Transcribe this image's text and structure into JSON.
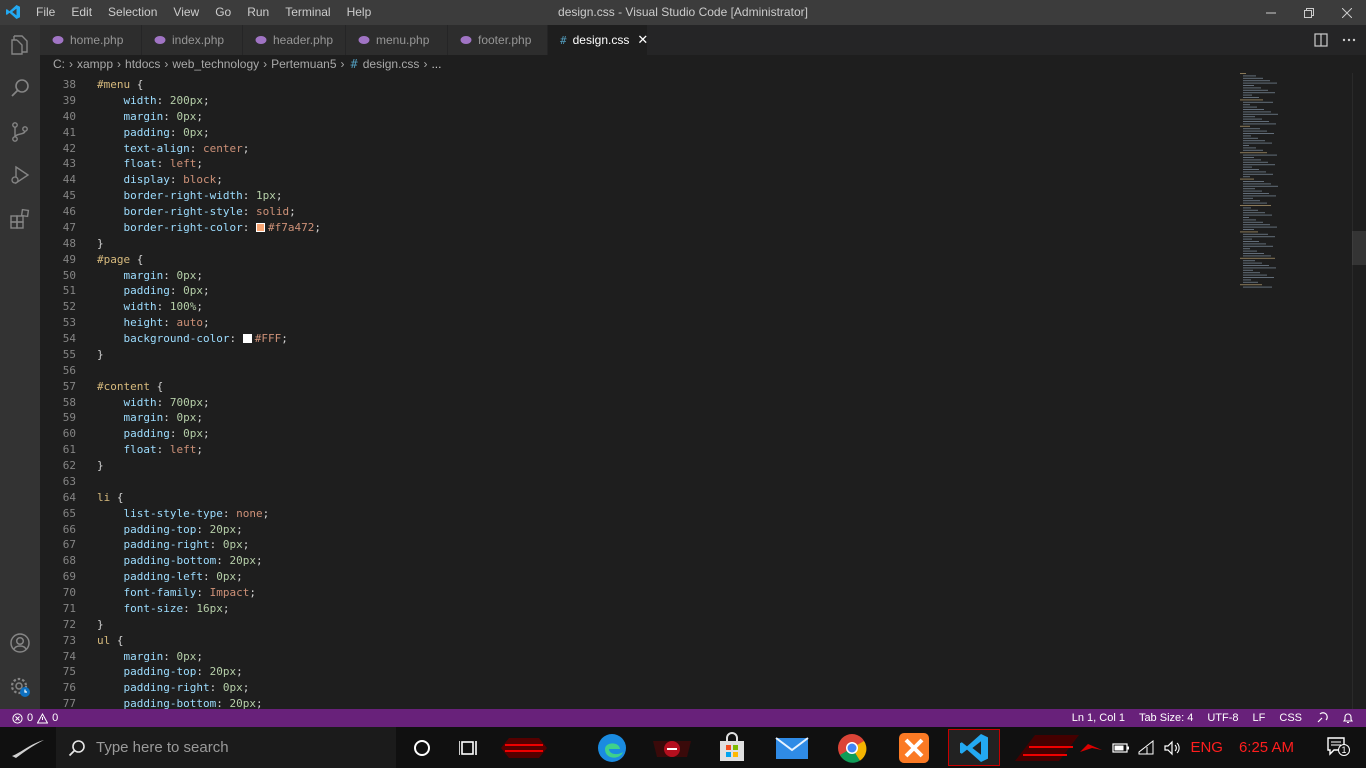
{
  "titlebar": {
    "menu": [
      "File",
      "Edit",
      "Selection",
      "View",
      "Go",
      "Run",
      "Terminal",
      "Help"
    ],
    "window_title": "design.css - Visual Studio Code [Administrator]"
  },
  "tabs": [
    {
      "label": "home.php",
      "icon": "php-file-icon",
      "active": false
    },
    {
      "label": "index.php",
      "icon": "php-file-icon",
      "active": false
    },
    {
      "label": "header.php",
      "icon": "php-file-icon",
      "active": false
    },
    {
      "label": "menu.php",
      "icon": "php-file-icon",
      "active": false
    },
    {
      "label": "footer.php",
      "icon": "php-file-icon",
      "active": false
    },
    {
      "label": "design.css",
      "icon": "css-file-icon",
      "active": true
    }
  ],
  "breadcrumb": [
    "C:",
    "xampp",
    "htdocs",
    "web_technology",
    "Pertemuan5",
    "design.css",
    "..."
  ],
  "code_lines": [
    {
      "n": "38",
      "t": [
        [
          "sel",
          "#menu"
        ],
        [
          "punc",
          " {"
        ]
      ]
    },
    {
      "n": "39",
      "t": [
        [
          "",
          "    "
        ],
        [
          "prop",
          "width"
        ],
        [
          "punc",
          ": "
        ],
        [
          "num",
          "200px"
        ],
        [
          "punc",
          ";"
        ]
      ]
    },
    {
      "n": "40",
      "t": [
        [
          "",
          "    "
        ],
        [
          "prop",
          "margin"
        ],
        [
          "punc",
          ": "
        ],
        [
          "num",
          "0px"
        ],
        [
          "punc",
          ";"
        ]
      ]
    },
    {
      "n": "41",
      "t": [
        [
          "",
          "    "
        ],
        [
          "prop",
          "padding"
        ],
        [
          "punc",
          ": "
        ],
        [
          "num",
          "0px"
        ],
        [
          "punc",
          ";"
        ]
      ]
    },
    {
      "n": "42",
      "t": [
        [
          "",
          "    "
        ],
        [
          "prop",
          "text-align"
        ],
        [
          "punc",
          ": "
        ],
        [
          "val",
          "center"
        ],
        [
          "punc",
          ";"
        ]
      ]
    },
    {
      "n": "43",
      "t": [
        [
          "",
          "    "
        ],
        [
          "prop",
          "float"
        ],
        [
          "punc",
          ": "
        ],
        [
          "val",
          "left"
        ],
        [
          "punc",
          ";"
        ]
      ]
    },
    {
      "n": "44",
      "t": [
        [
          "",
          "    "
        ],
        [
          "prop",
          "display"
        ],
        [
          "punc",
          ": "
        ],
        [
          "val",
          "block"
        ],
        [
          "punc",
          ";"
        ]
      ]
    },
    {
      "n": "45",
      "t": [
        [
          "",
          "    "
        ],
        [
          "prop",
          "border-right-width"
        ],
        [
          "punc",
          ": "
        ],
        [
          "num",
          "1px"
        ],
        [
          "punc",
          ";"
        ]
      ]
    },
    {
      "n": "46",
      "t": [
        [
          "",
          "    "
        ],
        [
          "prop",
          "border-right-style"
        ],
        [
          "punc",
          ": "
        ],
        [
          "val",
          "solid"
        ],
        [
          "punc",
          ";"
        ]
      ]
    },
    {
      "n": "47",
      "t": [
        [
          "",
          "    "
        ],
        [
          "prop",
          "border-right-color"
        ],
        [
          "punc",
          ": "
        ],
        [
          "swatch",
          "#f7a472"
        ],
        [
          "val",
          "#f7a472"
        ],
        [
          "punc",
          ";"
        ]
      ]
    },
    {
      "n": "48",
      "t": [
        [
          "punc",
          "}"
        ]
      ]
    },
    {
      "n": "49",
      "t": [
        [
          "sel",
          "#page"
        ],
        [
          "punc",
          " {"
        ]
      ]
    },
    {
      "n": "50",
      "t": [
        [
          "",
          "    "
        ],
        [
          "prop",
          "margin"
        ],
        [
          "punc",
          ": "
        ],
        [
          "num",
          "0px"
        ],
        [
          "punc",
          ";"
        ]
      ]
    },
    {
      "n": "51",
      "t": [
        [
          "",
          "    "
        ],
        [
          "prop",
          "padding"
        ],
        [
          "punc",
          ": "
        ],
        [
          "num",
          "0px"
        ],
        [
          "punc",
          ";"
        ]
      ]
    },
    {
      "n": "52",
      "t": [
        [
          "",
          "    "
        ],
        [
          "prop",
          "width"
        ],
        [
          "punc",
          ": "
        ],
        [
          "num",
          "100%"
        ],
        [
          "punc",
          ";"
        ]
      ]
    },
    {
      "n": "53",
      "t": [
        [
          "",
          "    "
        ],
        [
          "prop",
          "height"
        ],
        [
          "punc",
          ": "
        ],
        [
          "val",
          "auto"
        ],
        [
          "punc",
          ";"
        ]
      ]
    },
    {
      "n": "54",
      "t": [
        [
          "",
          "    "
        ],
        [
          "prop",
          "background-color"
        ],
        [
          "punc",
          ": "
        ],
        [
          "swatch",
          "#FFFFFF"
        ],
        [
          "val",
          "#FFF"
        ],
        [
          "punc",
          ";"
        ]
      ]
    },
    {
      "n": "55",
      "t": [
        [
          "punc",
          "}"
        ]
      ]
    },
    {
      "n": "56",
      "t": []
    },
    {
      "n": "57",
      "t": [
        [
          "sel",
          "#content"
        ],
        [
          "punc",
          " {"
        ]
      ]
    },
    {
      "n": "58",
      "t": [
        [
          "",
          "    "
        ],
        [
          "prop",
          "width"
        ],
        [
          "punc",
          ": "
        ],
        [
          "num",
          "700px"
        ],
        [
          "punc",
          ";"
        ]
      ]
    },
    {
      "n": "59",
      "t": [
        [
          "",
          "    "
        ],
        [
          "prop",
          "margin"
        ],
        [
          "punc",
          ": "
        ],
        [
          "num",
          "0px"
        ],
        [
          "punc",
          ";"
        ]
      ]
    },
    {
      "n": "60",
      "t": [
        [
          "",
          "    "
        ],
        [
          "prop",
          "padding"
        ],
        [
          "punc",
          ": "
        ],
        [
          "num",
          "0px"
        ],
        [
          "punc",
          ";"
        ]
      ]
    },
    {
      "n": "61",
      "t": [
        [
          "",
          "    "
        ],
        [
          "prop",
          "float"
        ],
        [
          "punc",
          ": "
        ],
        [
          "val",
          "left"
        ],
        [
          "punc",
          ";"
        ]
      ]
    },
    {
      "n": "62",
      "t": [
        [
          "punc",
          "}"
        ]
      ]
    },
    {
      "n": "63",
      "t": []
    },
    {
      "n": "64",
      "t": [
        [
          "sel",
          "li"
        ],
        [
          "punc",
          " {"
        ]
      ]
    },
    {
      "n": "65",
      "t": [
        [
          "",
          "    "
        ],
        [
          "prop",
          "list-style-type"
        ],
        [
          "punc",
          ": "
        ],
        [
          "val",
          "none"
        ],
        [
          "punc",
          ";"
        ]
      ]
    },
    {
      "n": "66",
      "t": [
        [
          "",
          "    "
        ],
        [
          "prop",
          "padding-top"
        ],
        [
          "punc",
          ": "
        ],
        [
          "num",
          "20px"
        ],
        [
          "punc",
          ";"
        ]
      ]
    },
    {
      "n": "67",
      "t": [
        [
          "",
          "    "
        ],
        [
          "prop",
          "padding-right"
        ],
        [
          "punc",
          ": "
        ],
        [
          "num",
          "0px"
        ],
        [
          "punc",
          ";"
        ]
      ]
    },
    {
      "n": "68",
      "t": [
        [
          "",
          "    "
        ],
        [
          "prop",
          "padding-bottom"
        ],
        [
          "punc",
          ": "
        ],
        [
          "num",
          "20px"
        ],
        [
          "punc",
          ";"
        ]
      ]
    },
    {
      "n": "69",
      "t": [
        [
          "",
          "    "
        ],
        [
          "prop",
          "padding-left"
        ],
        [
          "punc",
          ": "
        ],
        [
          "num",
          "0px"
        ],
        [
          "punc",
          ";"
        ]
      ]
    },
    {
      "n": "70",
      "t": [
        [
          "",
          "    "
        ],
        [
          "prop",
          "font-family"
        ],
        [
          "punc",
          ": "
        ],
        [
          "val",
          "Impact"
        ],
        [
          "punc",
          ";"
        ]
      ]
    },
    {
      "n": "71",
      "t": [
        [
          "",
          "    "
        ],
        [
          "prop",
          "font-size"
        ],
        [
          "punc",
          ": "
        ],
        [
          "num",
          "16px"
        ],
        [
          "punc",
          ";"
        ]
      ]
    },
    {
      "n": "72",
      "t": [
        [
          "punc",
          "}"
        ]
      ]
    },
    {
      "n": "73",
      "t": [
        [
          "sel",
          "ul"
        ],
        [
          "punc",
          " {"
        ]
      ]
    },
    {
      "n": "74",
      "t": [
        [
          "",
          "    "
        ],
        [
          "prop",
          "margin"
        ],
        [
          "punc",
          ": "
        ],
        [
          "num",
          "0px"
        ],
        [
          "punc",
          ";"
        ]
      ]
    },
    {
      "n": "75",
      "t": [
        [
          "",
          "    "
        ],
        [
          "prop",
          "padding-top"
        ],
        [
          "punc",
          ": "
        ],
        [
          "num",
          "20px"
        ],
        [
          "punc",
          ";"
        ]
      ]
    },
    {
      "n": "76",
      "t": [
        [
          "",
          "    "
        ],
        [
          "prop",
          "padding-right"
        ],
        [
          "punc",
          ": "
        ],
        [
          "num",
          "0px"
        ],
        [
          "punc",
          ";"
        ]
      ]
    },
    {
      "n": "77",
      "t": [
        [
          "",
          "    "
        ],
        [
          "prop",
          "padding-bottom"
        ],
        [
          "punc",
          ": "
        ],
        [
          "num",
          "20px"
        ],
        [
          "punc",
          ";"
        ]
      ]
    }
  ],
  "statusbar": {
    "errors": "0",
    "warnings": "0",
    "position": "Ln 1, Col 1",
    "tab_size": "Tab Size: 4",
    "encoding": "UTF-8",
    "eol": "LF",
    "language": "CSS"
  },
  "taskbar": {
    "search_placeholder": "Type here to search",
    "language": "ENG",
    "time": "6:25 AM",
    "notification_count": "1"
  },
  "colors": {
    "statusbar_bg": "#68217a",
    "accent_red": "#ff1e1e",
    "php_icon": "#a074c4",
    "css_icon": "#519aba"
  }
}
